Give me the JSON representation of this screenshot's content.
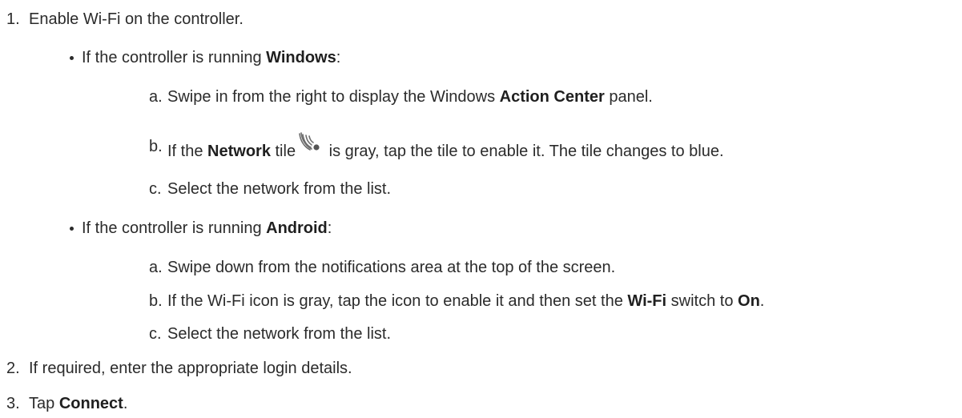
{
  "steps": [
    {
      "number": "1.",
      "text": "Enable Wi-Fi on the controller."
    },
    {
      "number": "2.",
      "text": "If required, enter the appropriate login details."
    },
    {
      "number": "3.",
      "text_before": "Tap ",
      "bold": "Connect",
      "text_after": "."
    }
  ],
  "windows": {
    "intro_before": "If the controller is running ",
    "intro_bold": "Windows",
    "intro_after": ":",
    "substeps": [
      {
        "letter": "a.",
        "before": "Swipe in from the right to display the Windows ",
        "bold": "Action Center",
        "after": " panel."
      },
      {
        "letter": "b.",
        "before": "If the ",
        "bold": "Network",
        "middle": " tile",
        "icon": "network-wifi-icon",
        "after": " is gray, tap the tile to enable it. The tile changes to blue."
      },
      {
        "letter": "c.",
        "text": "Select the network from the list."
      }
    ]
  },
  "android": {
    "intro_before": "If the controller is running ",
    "intro_bold": "Android",
    "intro_after": ":",
    "substeps": [
      {
        "letter": "a.",
        "text": "Swipe down from the notifications area at the top of the screen."
      },
      {
        "letter": "b.",
        "before": "If the Wi-Fi icon is gray, tap the icon to enable it and then set the ",
        "bold1": "Wi-Fi",
        "middle": " switch to ",
        "bold2": "On",
        "after": "."
      },
      {
        "letter": "c.",
        "text": "Select the network from the list."
      }
    ]
  }
}
